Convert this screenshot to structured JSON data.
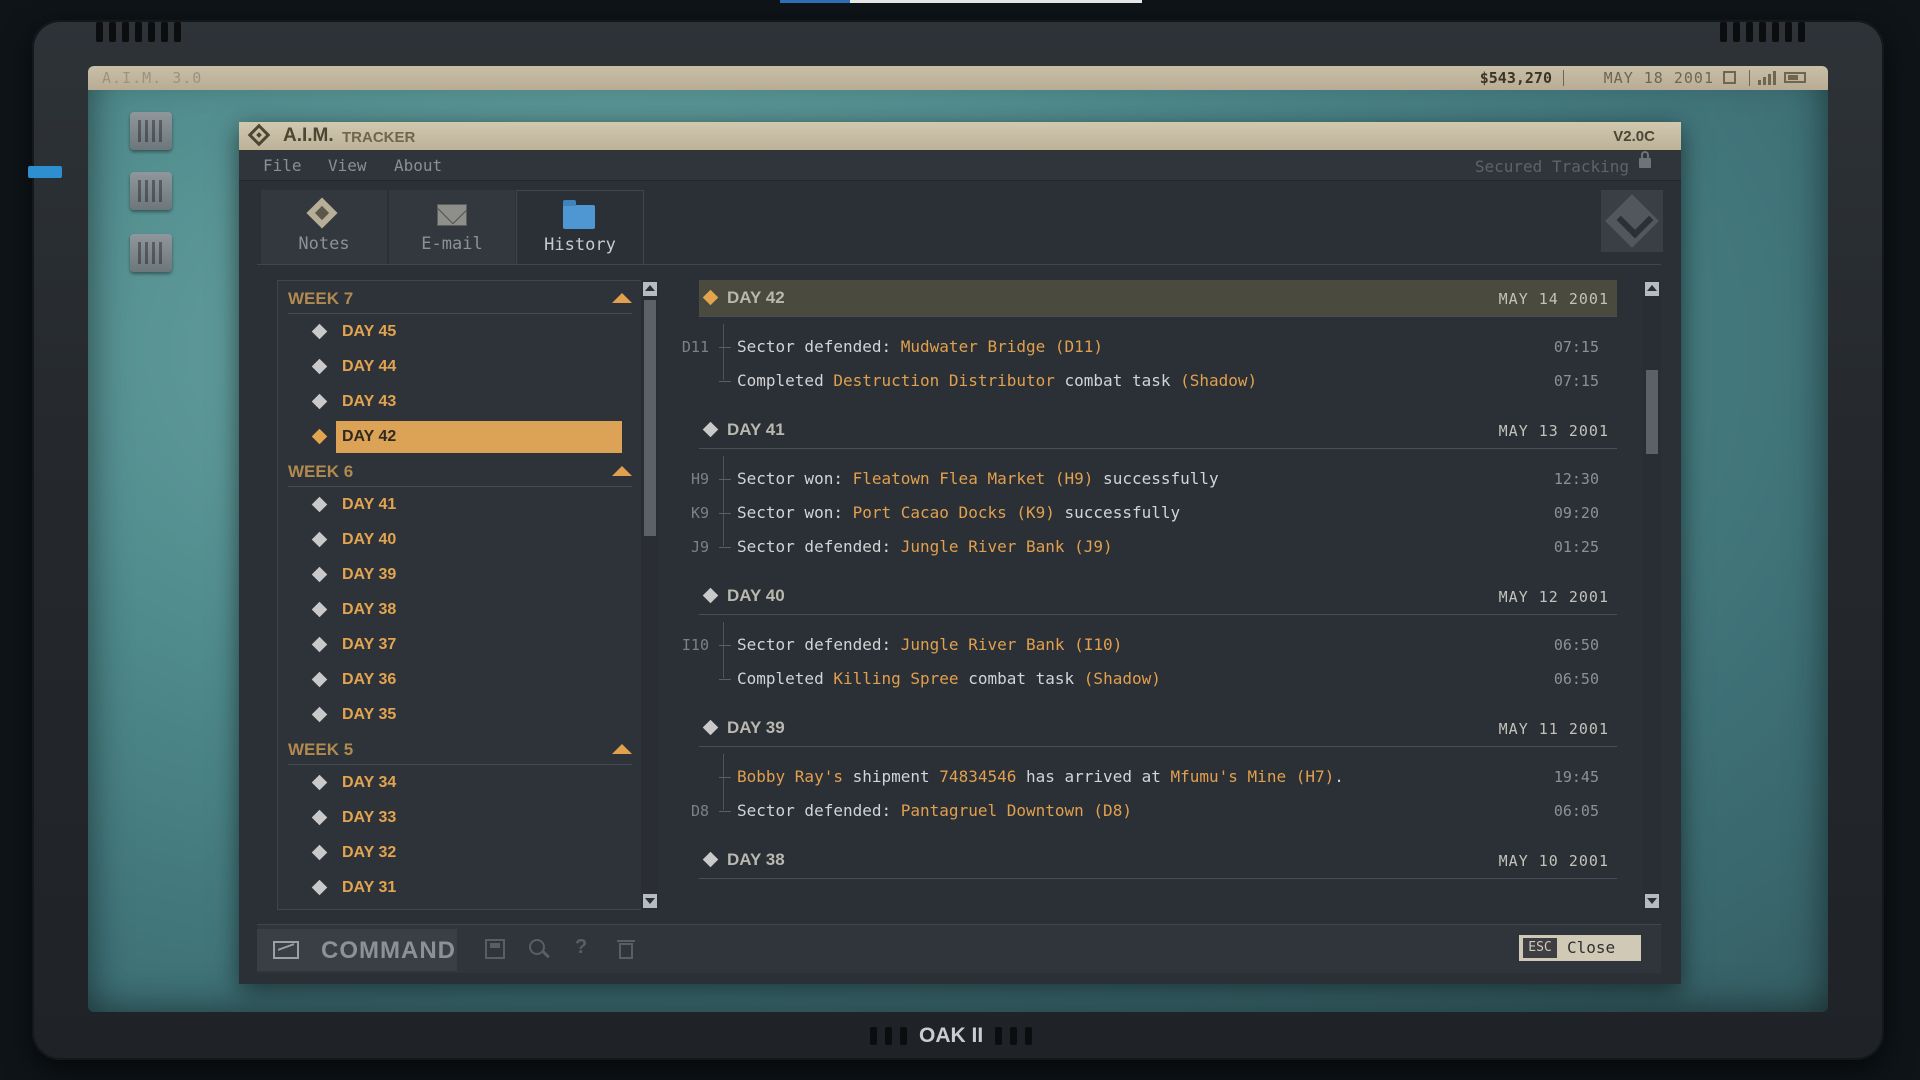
{
  "device": {
    "brand": "OAK II"
  },
  "statusbar": {
    "os_name": "A.I.M. 3.0",
    "money": "$543,270",
    "date": "MAY 18 2001"
  },
  "window": {
    "app_name": "A.I.M.",
    "app_subtitle": "TRACKER",
    "version": "V2.0C",
    "menu": [
      "File",
      "View",
      "About"
    ],
    "secured_label": "Secured Tracking",
    "tabs": [
      {
        "label": "Notes",
        "icon": "notes-diamond-icon",
        "active": false
      },
      {
        "label": "E-mail",
        "icon": "mail-envelope-icon",
        "active": false
      },
      {
        "label": "History",
        "icon": "folder-icon",
        "active": true
      }
    ]
  },
  "history_nav": {
    "weeks": [
      {
        "label": "WEEK 7",
        "days": [
          "DAY 45",
          "DAY 44",
          "DAY 43",
          "DAY 42"
        ]
      },
      {
        "label": "WEEK 6",
        "days": [
          "DAY 41",
          "DAY 40",
          "DAY 39",
          "DAY 38",
          "DAY 37",
          "DAY 36",
          "DAY 35"
        ]
      },
      {
        "label": "WEEK 5",
        "days": [
          "DAY 34",
          "DAY 33",
          "DAY 32",
          "DAY 31"
        ]
      }
    ],
    "selected_day": "DAY 42"
  },
  "history_log": [
    {
      "day": "DAY 42",
      "date": "MAY 14 2001",
      "highlighted": true,
      "events": [
        {
          "code": "D11",
          "parts": [
            [
              "Sector defended: ",
              false
            ],
            [
              "Mudwater Bridge (D11)",
              true
            ]
          ],
          "time": "07:15"
        },
        {
          "code": "",
          "parts": [
            [
              "Completed ",
              false
            ],
            [
              "Destruction Distributor",
              true
            ],
            [
              " combat task ",
              false
            ],
            [
              "(Shadow)",
              true
            ]
          ],
          "time": "07:15"
        }
      ]
    },
    {
      "day": "DAY 41",
      "date": "MAY 13 2001",
      "highlighted": false,
      "events": [
        {
          "code": "H9",
          "parts": [
            [
              "Sector won: ",
              false
            ],
            [
              "Fleatown Flea Market (H9)",
              true
            ],
            [
              " successfully",
              false
            ]
          ],
          "time": "12:30"
        },
        {
          "code": "K9",
          "parts": [
            [
              "Sector won: ",
              false
            ],
            [
              "Port Cacao Docks (K9)",
              true
            ],
            [
              " successfully",
              false
            ]
          ],
          "time": "09:20"
        },
        {
          "code": "J9",
          "parts": [
            [
              "Sector defended: ",
              false
            ],
            [
              "Jungle River Bank (J9)",
              true
            ]
          ],
          "time": "01:25"
        }
      ]
    },
    {
      "day": "DAY 40",
      "date": "MAY 12 2001",
      "highlighted": false,
      "events": [
        {
          "code": "I10",
          "parts": [
            [
              "Sector defended: ",
              false
            ],
            [
              "Jungle River Bank (I10)",
              true
            ]
          ],
          "time": "06:50"
        },
        {
          "code": "",
          "parts": [
            [
              "Completed ",
              false
            ],
            [
              "Killing Spree",
              true
            ],
            [
              " combat task ",
              false
            ],
            [
              "(Shadow)",
              true
            ]
          ],
          "time": "06:50"
        }
      ]
    },
    {
      "day": "DAY 39",
      "date": "MAY 11 2001",
      "highlighted": false,
      "events": [
        {
          "code": "",
          "parts": [
            [
              "Bobby Ray's",
              true
            ],
            [
              " shipment ",
              false
            ],
            [
              "74834546",
              true
            ],
            [
              " has arrived at ",
              false
            ],
            [
              "Mfumu's Mine (H7)",
              true
            ],
            [
              ".",
              false
            ]
          ],
          "time": "19:45"
        },
        {
          "code": "D8",
          "parts": [
            [
              "Sector defended: ",
              false
            ],
            [
              "Pantagruel Downtown (D8)",
              true
            ]
          ],
          "time": "06:05"
        }
      ]
    },
    {
      "day": "DAY 38",
      "date": "MAY 10 2001",
      "highlighted": false,
      "events": []
    }
  ],
  "bottombar": {
    "command_label": "COMMAND",
    "esc_key": "ESC",
    "close_label": "Close"
  },
  "colors": {
    "accent": "#e0a04e",
    "screen": "#4f8a8c",
    "window": "#2b2f36"
  }
}
